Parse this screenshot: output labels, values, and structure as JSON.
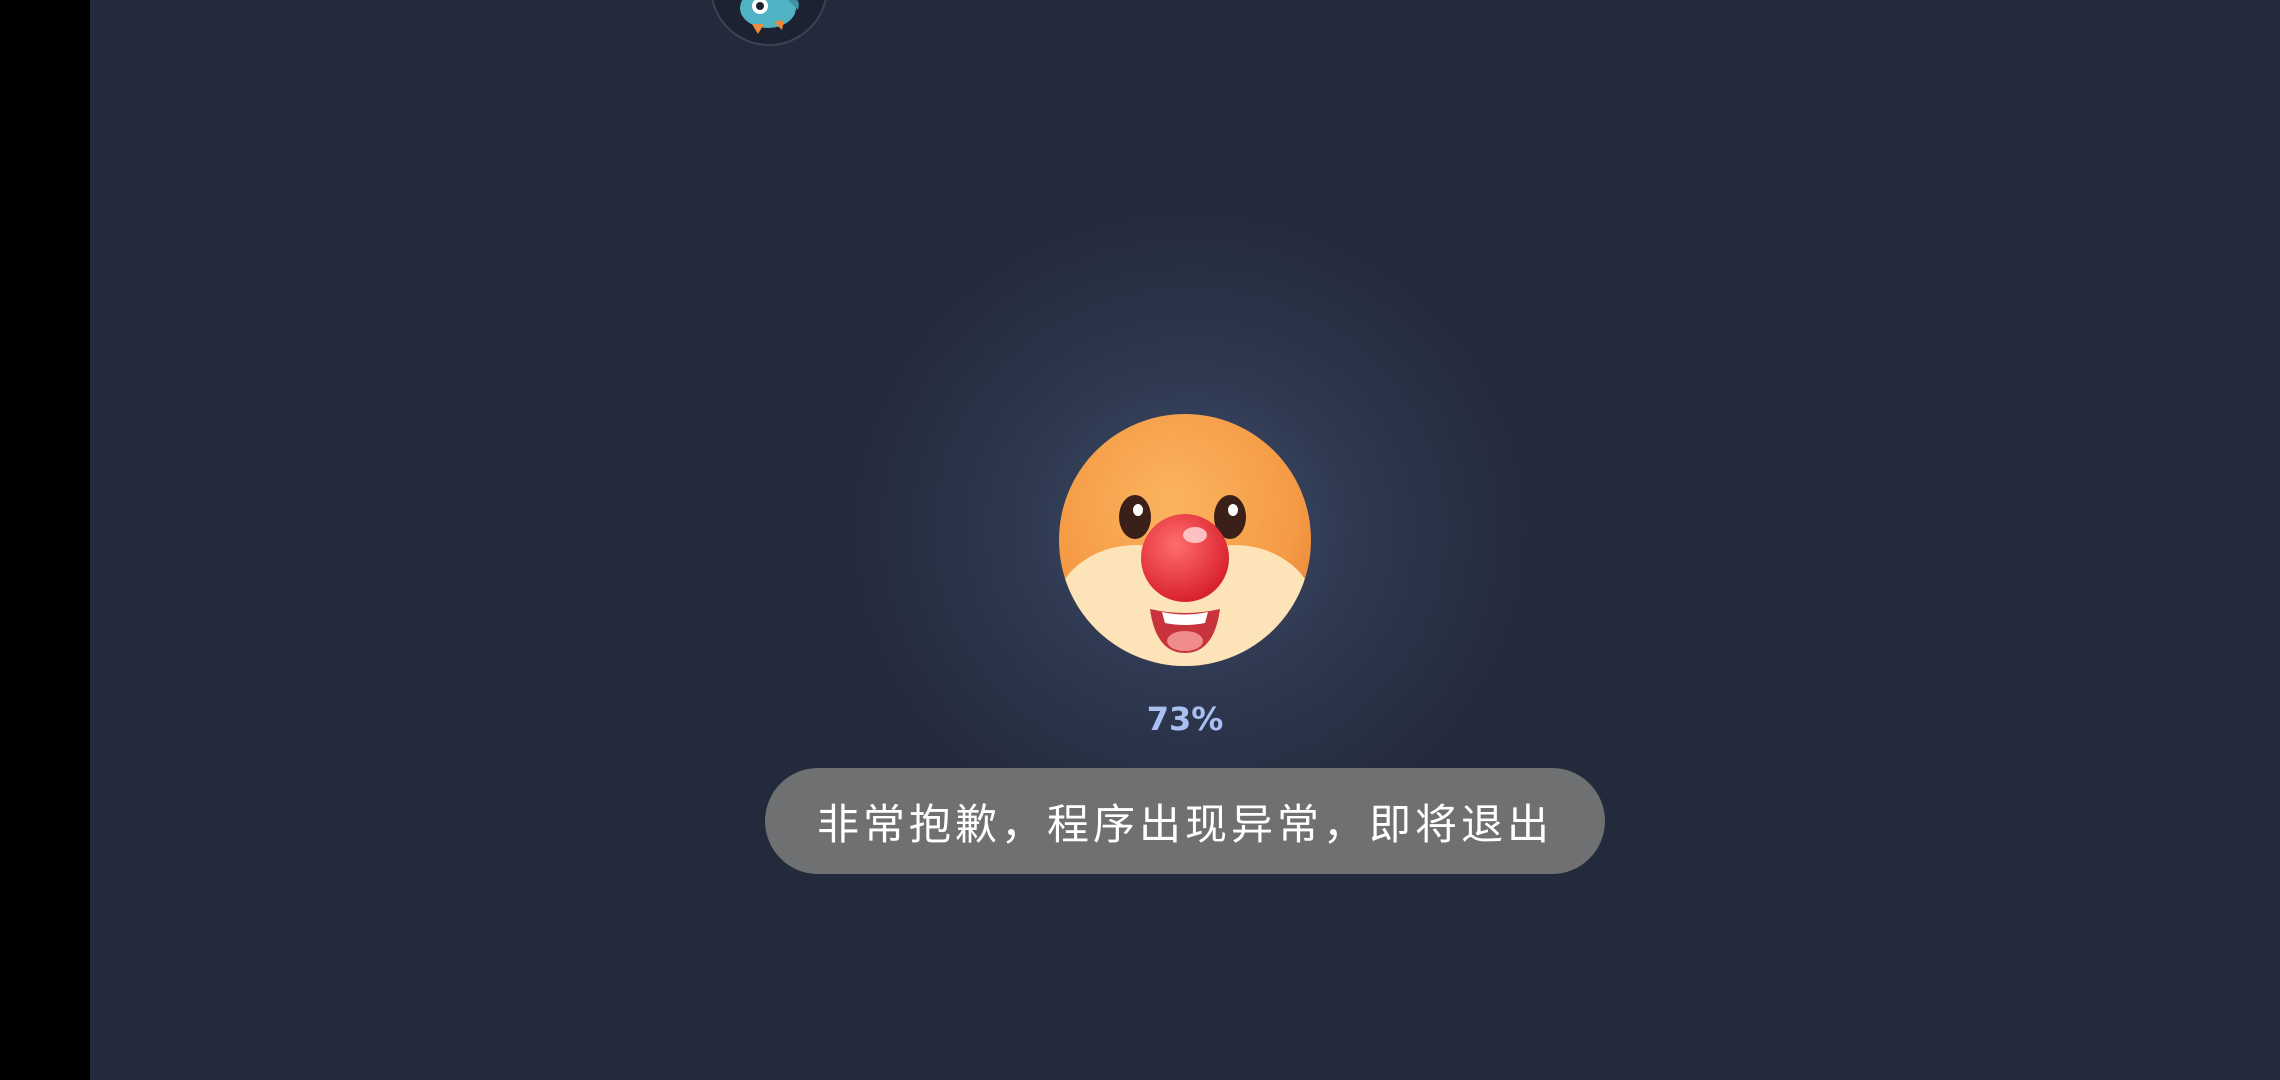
{
  "loading": {
    "progress_percent": 73,
    "progress_label": "73%"
  },
  "toast": {
    "message": "非常抱歉，程序出现异常，即将退出"
  },
  "icons": {
    "top_avatar": "bird-avatar-icon",
    "mascot": "mascot-face-icon"
  },
  "colors": {
    "background": "#232a3b",
    "progress_text": "#aac0f2",
    "toast_background": "#767676",
    "mascot_face": "#f6a04a",
    "mascot_nose": "#e8323c"
  }
}
